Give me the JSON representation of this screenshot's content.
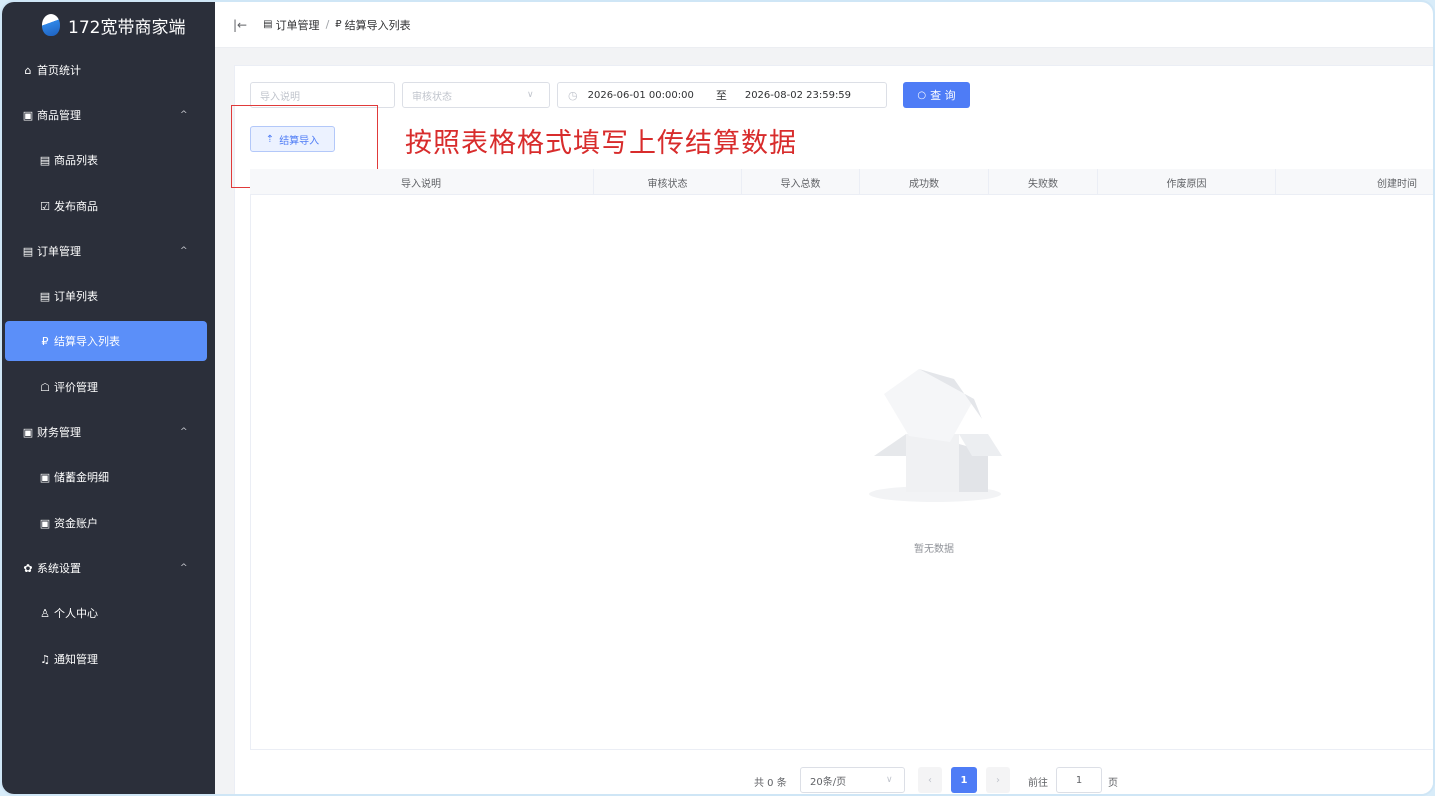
{
  "app": {
    "title": "172宽带商家端"
  },
  "sidebar": {
    "items": [
      {
        "label": "首页统计",
        "icon": "home-icon",
        "glyph": "⌂"
      },
      {
        "label": "商品管理",
        "icon": "goods-icon",
        "glyph": "▣"
      },
      {
        "label": "商品列表",
        "icon": "list-icon",
        "glyph": "▤"
      },
      {
        "label": "发布商品",
        "icon": "edit-icon",
        "glyph": "☑"
      },
      {
        "label": "订单管理",
        "icon": "order-icon",
        "glyph": "▤"
      },
      {
        "label": "订单列表",
        "icon": "list-icon",
        "glyph": "▤"
      },
      {
        "label": "结算导入列表",
        "icon": "settle-icon",
        "glyph": "₽"
      },
      {
        "label": "评价管理",
        "icon": "review-icon",
        "glyph": "☖"
      },
      {
        "label": "财务管理",
        "icon": "finance-icon",
        "glyph": "▣"
      },
      {
        "label": "储蓄金明细",
        "icon": "detail-icon",
        "glyph": "▣"
      },
      {
        "label": "资金账户",
        "icon": "account-icon",
        "glyph": "▣"
      },
      {
        "label": "系统设置",
        "icon": "gear-icon",
        "glyph": "✿"
      },
      {
        "label": "个人中心",
        "icon": "user-icon",
        "glyph": "♙"
      },
      {
        "label": "通知管理",
        "icon": "bell-icon",
        "glyph": "♫"
      }
    ],
    "chevron": "^"
  },
  "header": {
    "collapse": "|←",
    "breadcrumb": [
      "订单管理",
      "结算导入列表"
    ],
    "sep": "/"
  },
  "filters": {
    "description_placeholder": "导入说明",
    "status_placeholder": "审核状态",
    "date_start": "2026-06-01 00:00:00",
    "date_to": "至",
    "date_end": "2026-08-02 23:59:59",
    "query_label": "查 询"
  },
  "actions": {
    "import_label": "结算导入"
  },
  "annotation": "按照表格格式填写上传结算数据",
  "table": {
    "columns": [
      "导入说明",
      "审核状态",
      "导入总数",
      "成功数",
      "失败数",
      "作废原因",
      "创建时间"
    ],
    "empty_text": "暂无数据"
  },
  "pagination": {
    "total": "共 0 条",
    "page_size": "20条/页",
    "current_page": "1",
    "goto_label": "前往",
    "goto_value": "1",
    "page_unit": "页"
  },
  "colors": {
    "sidebar_bg": "#2b2f3a",
    "accent": "#4e7cf6",
    "annotation": "#d82c2c"
  }
}
